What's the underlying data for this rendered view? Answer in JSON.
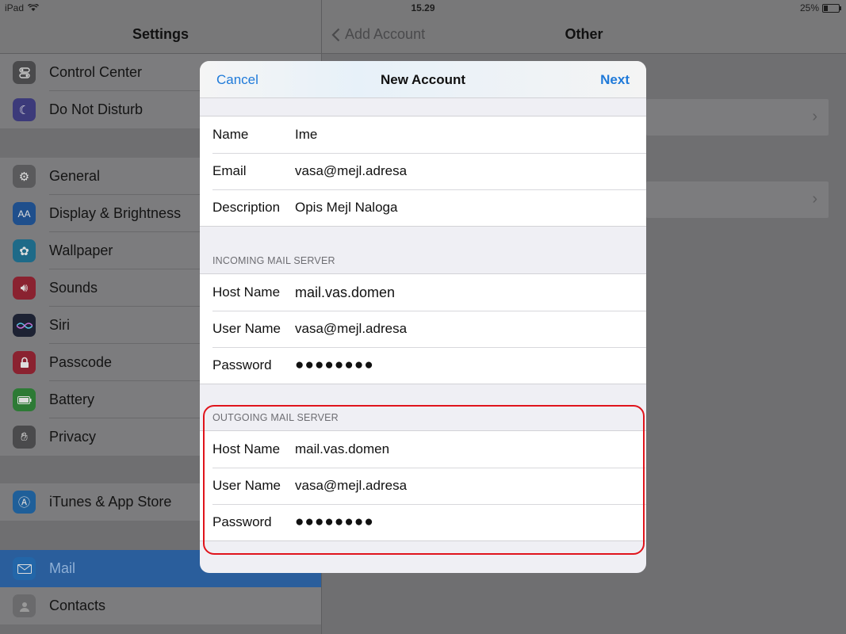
{
  "status_bar": {
    "device": "iPad",
    "time": "15.29",
    "battery": "25%",
    "battery_level": 0.25
  },
  "sidebar": {
    "title": "Settings",
    "groups": [
      {
        "items": [
          {
            "label": "Control Center",
            "icon": "control-center-icon",
            "color": "#4a4a4c"
          },
          {
            "label": "Do Not Disturb",
            "icon": "moon-icon",
            "color": "#3c3a7a"
          }
        ]
      },
      {
        "items": [
          {
            "label": "General",
            "icon": "gear-icon",
            "color": "#5a5a5c"
          },
          {
            "label": "Display & Brightness",
            "icon": "display-icon",
            "color": "#1f4f8c"
          },
          {
            "label": "Wallpaper",
            "icon": "wallpaper-icon",
            "color": "#1e6a88"
          },
          {
            "label": "Sounds",
            "icon": "speaker-icon",
            "color": "#8a2230"
          },
          {
            "label": "Siri",
            "icon": "siri-icon",
            "color": "#1d2233"
          },
          {
            "label": "Passcode",
            "icon": "lock-icon",
            "color": "#8a2230"
          },
          {
            "label": "Battery",
            "icon": "battery-icon",
            "color": "#2d7a35"
          },
          {
            "label": "Privacy",
            "icon": "hand-icon",
            "color": "#4a4a4c"
          }
        ]
      },
      {
        "items": [
          {
            "label": "iTunes & App Store",
            "icon": "app-store-icon",
            "color": "#1f5f99"
          }
        ]
      },
      {
        "items": [
          {
            "label": "Mail",
            "icon": "envelope-icon",
            "color": "#2366a8",
            "selected": true
          },
          {
            "label": "Contacts",
            "icon": "contacts-icon",
            "color": "#6a6a6c"
          }
        ]
      }
    ]
  },
  "detail": {
    "back_label": "Add Account",
    "title": "Other"
  },
  "modal": {
    "cancel_label": "Cancel",
    "title": "New Account",
    "next_label": "Next",
    "account": [
      {
        "label": "Name",
        "value": "Ime"
      },
      {
        "label": "Email",
        "value": "vasa@mejl.adresa"
      },
      {
        "label": "Description",
        "value": "Opis Mejl Naloga"
      }
    ],
    "incoming_header": "INCOMING MAIL SERVER",
    "incoming": [
      {
        "label": "Host Name",
        "value": "mail.vas.domen"
      },
      {
        "label": "User Name",
        "value": "vasa@mejl.adresa"
      },
      {
        "label": "Password",
        "value": "●●●●●●●●"
      }
    ],
    "outgoing_header": "OUTGOING MAIL SERVER",
    "outgoing": [
      {
        "label": "Host Name",
        "value": "mail.vas.domen"
      },
      {
        "label": "User Name",
        "value": "vasa@mejl.adresa"
      },
      {
        "label": "Password",
        "value": "●●●●●●●●"
      }
    ]
  },
  "colors": {
    "accent": "#1f7ad9",
    "highlight": "#e0141c",
    "selected": "#2a5e9c"
  }
}
